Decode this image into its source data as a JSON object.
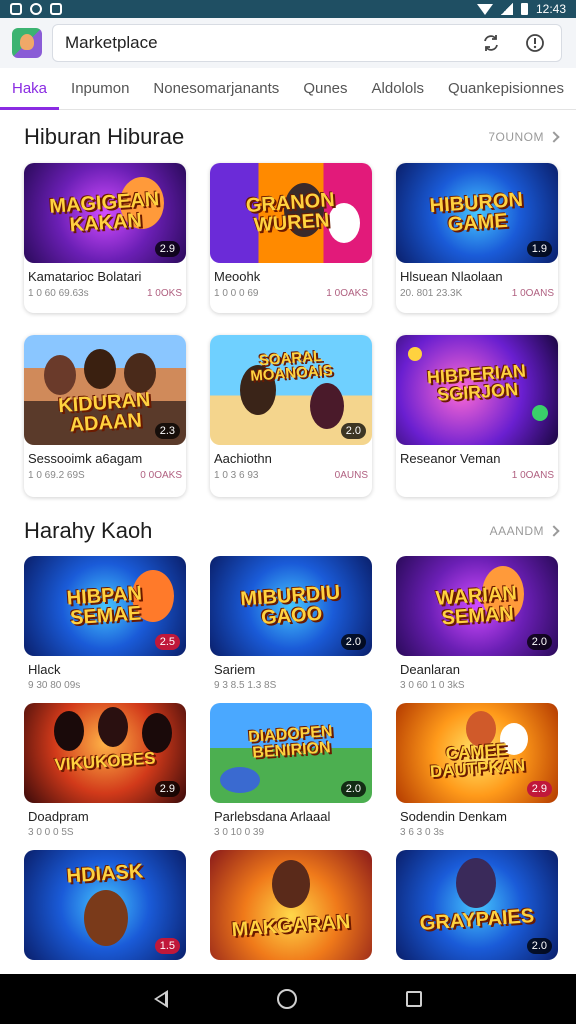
{
  "status_bar": {
    "time": "12:43"
  },
  "app_bar": {
    "title": "Marketplace"
  },
  "tabs": [
    {
      "label": "Haka",
      "active": true
    },
    {
      "label": "Inpumon",
      "active": false
    },
    {
      "label": "Nonesomarjanants",
      "active": false
    },
    {
      "label": "Qunes",
      "active": false
    },
    {
      "label": "Aldolols",
      "active": false
    },
    {
      "label": "Quankepisionnes",
      "active": false
    }
  ],
  "sections": [
    {
      "title": "Hiburan Hiburae",
      "see_all": "7OUNOM",
      "items": [
        {
          "title": "Kamatarioc Bolatari",
          "thumb_text": "MAGIGEAN KAKAN",
          "badge": "2.9",
          "meta": "1 0 60 69.63s",
          "price": "1 0OKS"
        },
        {
          "title": "Meoohk",
          "thumb_text": "GRANON WUREN",
          "badge": "",
          "meta": "1 0 0 0 69",
          "price": "1 0OAKS"
        },
        {
          "title": "Hlsuean Nlaolaan",
          "thumb_text": "HIBURON GAME",
          "badge": "1.9",
          "meta": "20. 801 23.3K",
          "price": "1 0OANS"
        },
        {
          "title": "Sessooimk a6agam",
          "thumb_text": "KIDURAN ADAAN",
          "badge": "2.3",
          "meta": "1 0 69.2 69S",
          "price": "0 0OAKS"
        },
        {
          "title": "Aachiothn",
          "thumb_text": "SOARAL MOANOAIS",
          "badge": "2.0",
          "meta": "1 0 3 6 93",
          "price": "0AUNS"
        },
        {
          "title": "Reseanor Veman",
          "thumb_text": "HIBPERIAN SGIRJON",
          "badge": "",
          "meta": "",
          "price": "1 0OANS"
        }
      ]
    },
    {
      "title": "Harahy Kaoh",
      "see_all": "AAANDM",
      "items": [
        {
          "title": "Hlack",
          "thumb_text": "HIBPAN SEMAE",
          "badge": "2.5",
          "meta": "9 30 80 09s",
          "price": ""
        },
        {
          "title": "Sariem",
          "thumb_text": "MIBURDIU GAOO",
          "badge": "2.0",
          "meta": "9 3 8.5 1.3 8S",
          "price": ""
        },
        {
          "title": "Deanlaran",
          "thumb_text": "WARIAN SEMAN",
          "badge": "2.0",
          "meta": "3 0 60 1 0 3kS",
          "price": ""
        },
        {
          "title": "Doadpram",
          "thumb_text": "VIKUKOBES",
          "badge": "2.9",
          "meta": "3 0 0 0 5S",
          "price": ""
        },
        {
          "title": "Parlebsdana Arlaaal",
          "thumb_text": "DIADOPEN BENIRION",
          "badge": "2.0",
          "meta": "3 0 10 0 39",
          "price": ""
        },
        {
          "title": "Sodendin Denkam",
          "thumb_text": "CAMEE DAUTPKAN",
          "badge": "2.9",
          "meta": "3 6 3 0 3s",
          "price": ""
        },
        {
          "title": "",
          "thumb_text": "HDIASK",
          "badge": "1.5",
          "meta": "",
          "price": ""
        },
        {
          "title": "",
          "thumb_text": "MAKGARAN",
          "badge": "",
          "meta": "",
          "price": ""
        },
        {
          "title": "",
          "thumb_text": "GRAYPAIES",
          "badge": "2.0",
          "meta": "",
          "price": ""
        }
      ]
    }
  ]
}
